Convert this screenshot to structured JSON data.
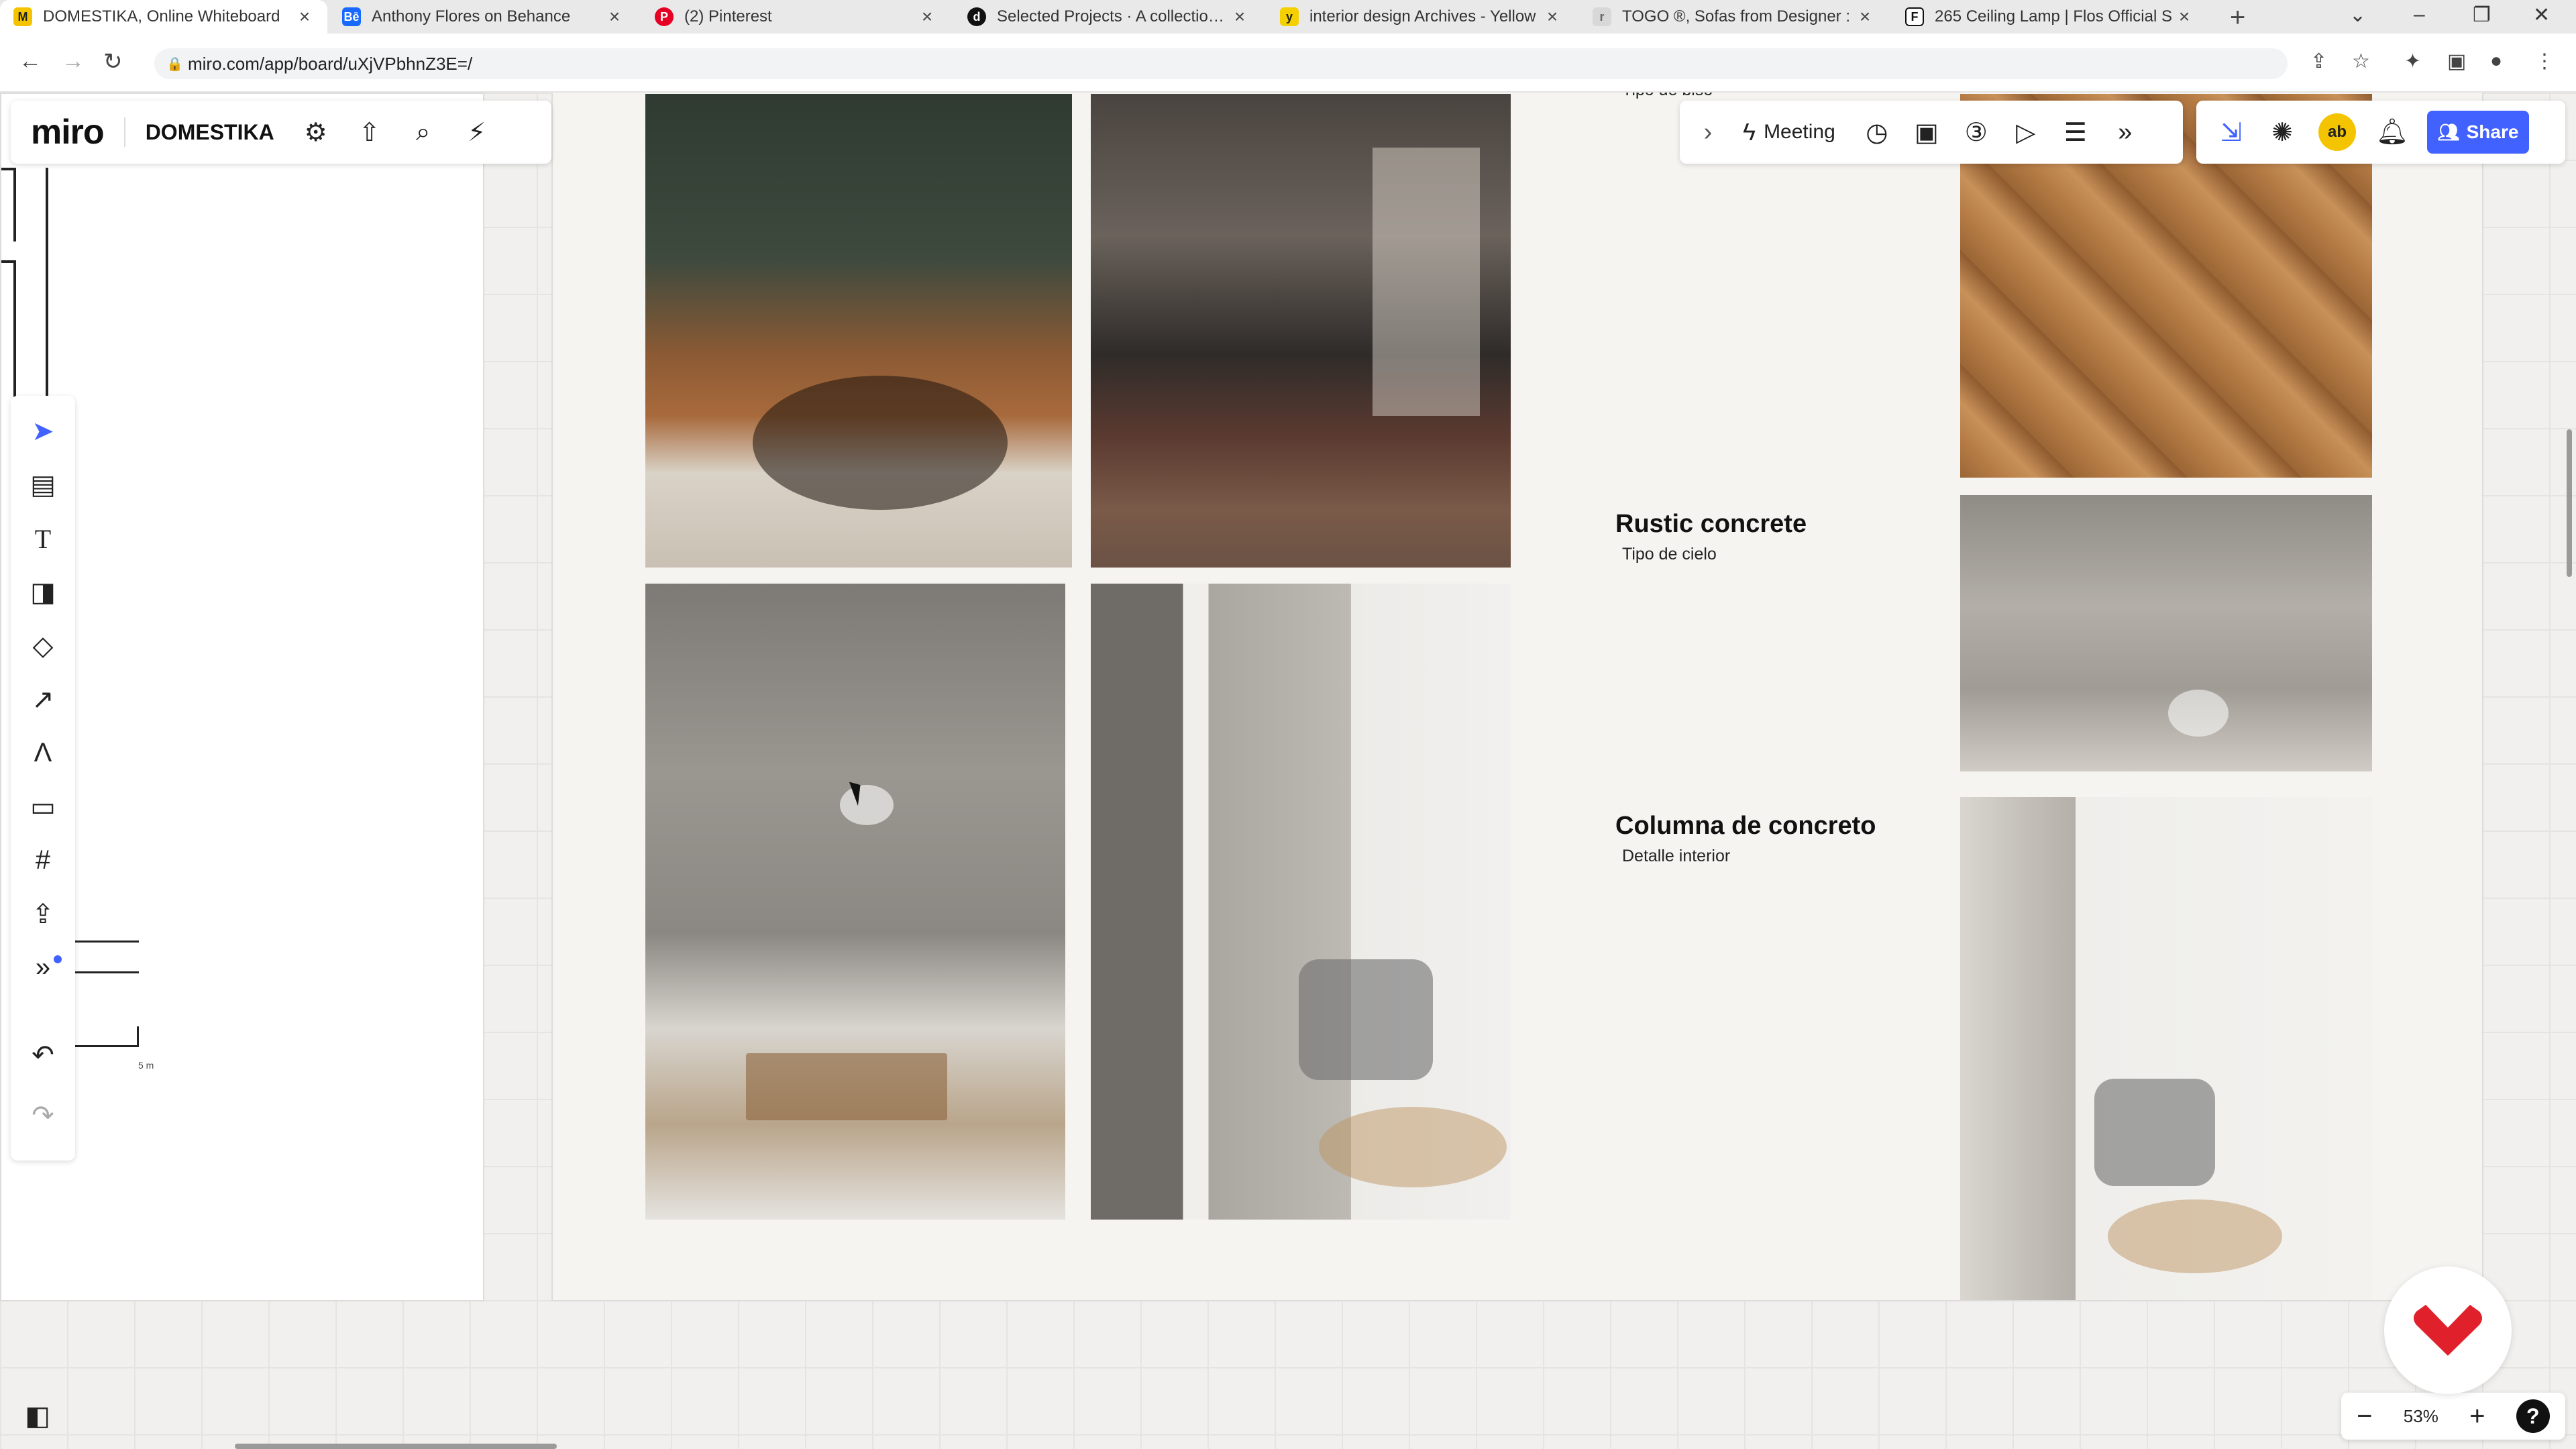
{
  "browser": {
    "tabs": [
      {
        "label": "DOMESTIKA, Online Whiteboard",
        "favicon": "miro-favicon",
        "active": true
      },
      {
        "label": "Anthony Flores on Behance",
        "favicon": "behance-favicon",
        "active": false
      },
      {
        "label": "(2) Pinterest",
        "favicon": "pinterest-favicon",
        "active": false
      },
      {
        "label": "Selected Projects · A collection o",
        "favicon": "domestika-favicon",
        "active": false
      },
      {
        "label": "interior design Archives - Yellow",
        "favicon": "yellowtrace-favicon",
        "active": false
      },
      {
        "label": "TOGO ®, Sofas from Designer :",
        "favicon": "ligne-roset-favicon",
        "active": false
      },
      {
        "label": "265 Ceiling Lamp | Flos Official S",
        "favicon": "flos-favicon",
        "active": false
      }
    ],
    "url": "miro.com/app/board/uXjVPbhnZ3E=/"
  },
  "miro": {
    "logo": "miro",
    "board_name": "DOMESTIKA",
    "meeting_label": "Meeting",
    "share_label": "Share",
    "avatar_initials": "ab",
    "zoom_level": "53%",
    "help_label": "?",
    "accent_color": "#4262ff"
  },
  "board": {
    "top_caption": "Tipo de biso",
    "sections": [
      {
        "title": "Rustic concrete",
        "subtitle": "Tipo de cielo"
      },
      {
        "title": "Columna de concreto",
        "subtitle": "Detalle interior"
      }
    ],
    "sketch_label": "5 m"
  }
}
